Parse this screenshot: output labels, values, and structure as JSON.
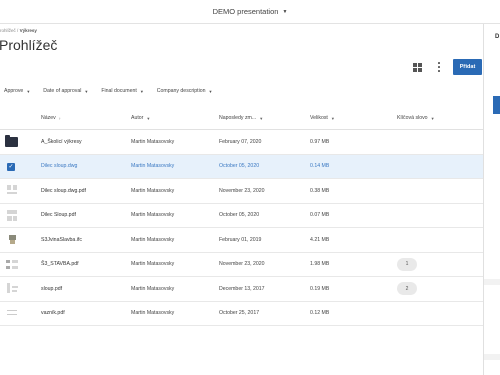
{
  "topbar": {
    "title": "DEMO presentation"
  },
  "breadcrumb": {
    "parent": "rohlížeč",
    "separator": "/",
    "current": "Výkresy"
  },
  "page": {
    "title": "Prohlížeč"
  },
  "toolbar": {
    "add_label": "Přidat"
  },
  "filters": [
    {
      "label": "Approve"
    },
    {
      "label": "Date of approval"
    },
    {
      "label": "Final document"
    },
    {
      "label": "Company description"
    }
  ],
  "columns": {
    "name": "Název",
    "author": "Autor",
    "modified": "Naposledy zm...",
    "size": "Velikost",
    "keyword": "Klíčová slovo"
  },
  "rows": [
    {
      "name": "A_Školicí výkresy",
      "author": "Martin Matasovsky",
      "modified": "February 07, 2020",
      "size": "0.97 MB",
      "tag": "",
      "icon": "folder-icon",
      "selected": false
    },
    {
      "name": "Dilec sloup.dwg",
      "author": "Martin Matasovsky",
      "modified": "October 05, 2020",
      "size": "0.14 MB",
      "tag": "",
      "icon": "checkbox-icon",
      "selected": true
    },
    {
      "name": "Dilec sloup.dwg.pdf",
      "author": "Martin Matasovsky",
      "modified": "November 23, 2020",
      "size": "0.38 MB",
      "tag": "",
      "icon": "document-thumbnail-icon",
      "selected": false
    },
    {
      "name": "Dilec Sloup.pdf",
      "author": "Martin Matasovsky",
      "modified": "October 05, 2020",
      "size": "0.07 MB",
      "tag": "",
      "icon": "document-thumbnail-icon",
      "selected": false
    },
    {
      "name": "S3JvinaSlavba.ifc",
      "author": "Martin Matasovsky",
      "modified": "February 01, 2019",
      "size": "4.21 MB",
      "tag": "",
      "icon": "model-thumbnail-icon",
      "selected": false
    },
    {
      "name": "Š3_STAVBA.pdf",
      "author": "Martin Matasovsky",
      "modified": "November 23, 2020",
      "size": "1.98 MB",
      "tag": "1",
      "icon": "document-thumbnail-icon",
      "selected": false
    },
    {
      "name": "sloup.pdf",
      "author": "Martin Matasovsky",
      "modified": "December 13, 2017",
      "size": "0.19 MB",
      "tag": "2",
      "icon": "document-thumbnail-icon",
      "selected": false
    },
    {
      "name": "vazník.pdf",
      "author": "Martin Matasovsky",
      "modified": "October 25, 2017",
      "size": "0.12 MB",
      "tag": "",
      "icon": "document-thumbnail-icon",
      "selected": false
    }
  ],
  "right_panel": {
    "title": "D"
  },
  "colors": {
    "accent": "#2a6ab5",
    "selected_row": "#e7f1fb",
    "folder": "#2b3140"
  }
}
